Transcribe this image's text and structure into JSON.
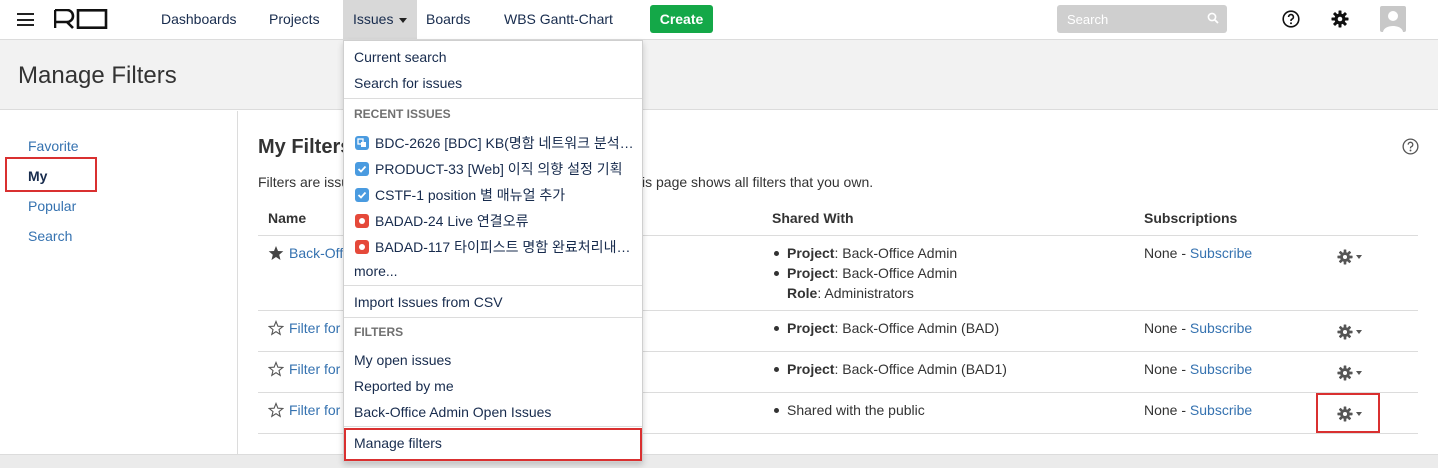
{
  "nav": {
    "items": [
      "Dashboards",
      "Projects",
      "Issues",
      "Boards",
      "WBS Gantt-Chart"
    ],
    "create_label": "Create",
    "search_placeholder": "Search"
  },
  "page": {
    "title": "Manage Filters"
  },
  "sidebar": {
    "items": [
      "Favorite",
      "My",
      "Popular",
      "Search"
    ],
    "selected": "My"
  },
  "main": {
    "title": "My Filters",
    "desc_start": "Filters are issu",
    "desc_end": "is page shows all filters that you own.",
    "columns": {
      "name": "Name",
      "shared": "Shared With",
      "subs": "Subscriptions"
    },
    "rows": [
      {
        "name": "Back-Off",
        "favorite": true,
        "shared": [
          {
            "label": "Project",
            "value": ": Back-Office Admin",
            "bullet": true
          },
          {
            "label": "Project",
            "value": ": Back-Office Admin",
            "bullet": true
          },
          {
            "label": "Role",
            "value": ": Administrators",
            "bullet": false
          }
        ],
        "subs_none": "None - ",
        "subs_link": "Subscribe"
      },
      {
        "name": "Filter for",
        "favorite": false,
        "shared": [
          {
            "label": "Project",
            "value": ": Back-Office Admin (BAD)",
            "bullet": true
          }
        ],
        "subs_none": "None - ",
        "subs_link": "Subscribe"
      },
      {
        "name": "Filter for",
        "favorite": false,
        "shared": [
          {
            "label": "Project",
            "value": ": Back-Office Admin (BAD1)",
            "bullet": true
          }
        ],
        "subs_none": "None - ",
        "subs_link": "Subscribe"
      },
      {
        "name": "Filter for",
        "favorite": false,
        "shared": [
          {
            "label": "",
            "value": "Shared with the public",
            "bullet": true
          }
        ],
        "subs_none": "None - ",
        "subs_link": "Subscribe"
      }
    ]
  },
  "dropdown": {
    "current_search": "Current search",
    "search_for_issues": "Search for issues",
    "recent_header": "RECENT ISSUES",
    "recent": [
      {
        "type": "subtask",
        "text": "BDC-2626 [BDC] KB(명함 네트워크 분석…"
      },
      {
        "type": "task",
        "text": "PRODUCT-33 [Web] 이직 의향 설정 기획"
      },
      {
        "type": "task",
        "text": "CSTF-1 position 별 매뉴얼 추가"
      },
      {
        "type": "bug",
        "text": "BADAD-24 Live 연결오류"
      },
      {
        "type": "bug",
        "text": "BADAD-117 타이피스트 명함 완료처리내…"
      }
    ],
    "more": "more...",
    "import_csv": "Import Issues from CSV",
    "filters_header": "FILTERS",
    "filters": [
      "My open issues",
      "Reported by me",
      "Back-Office Admin Open Issues"
    ],
    "manage_filters": "Manage filters"
  },
  "colors": {
    "link": "#3572b0",
    "create": "#14a848",
    "highlight": "#d93030",
    "bug": "#e5493a",
    "task": "#4a9be0"
  }
}
